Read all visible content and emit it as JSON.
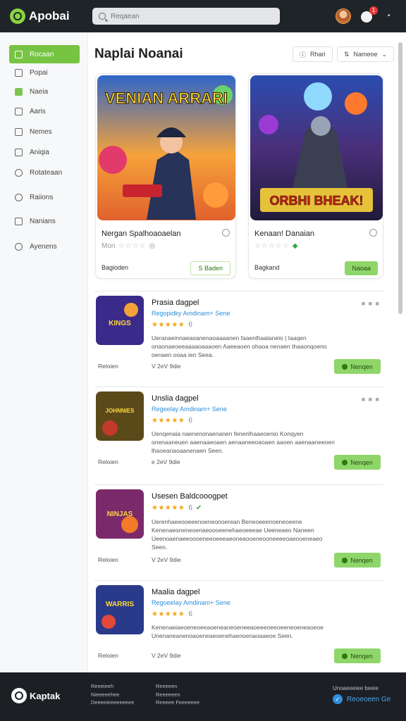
{
  "app": {
    "name": "Apobai"
  },
  "search": {
    "placeholder": "Reqaean"
  },
  "header": {
    "notification_count": "1"
  },
  "sidebar": {
    "items": [
      {
        "label": "Rocaan"
      },
      {
        "label": "Popai"
      },
      {
        "label": "Naeia"
      },
      {
        "label": "Aaris"
      },
      {
        "label": "Nemes"
      },
      {
        "label": "Aniqia"
      },
      {
        "label": "Rotateaan"
      },
      {
        "label": "Raiions"
      },
      {
        "label": "Nanians"
      },
      {
        "label": "Ayenens"
      }
    ]
  },
  "main": {
    "title": "Naplai Noanai",
    "filters": [
      {
        "label": "Rhari"
      },
      {
        "label": "Nameoe"
      }
    ]
  },
  "featured": [
    {
      "name": "Nergan Spalhoaoaelan",
      "rating_label": "Mon",
      "developer": "Bagioden",
      "button_label": "S Baden",
      "art_title": "VENIAN ARRARI"
    },
    {
      "name": "Kenaan! Danaian",
      "rating_label": "",
      "developer": "Bagkand",
      "button_label": "Naoaa",
      "art_title": "ORBHI BHEAK!"
    }
  ],
  "apps": [
    {
      "title": "Prasia dagpel",
      "subtitle": "Regopidky Amdinam+ Sene",
      "rating_suffix": "6",
      "description": "Ueranaeinnaeaoanenaoaaaanen faaenlhaalaneio | Iaaqen onaonaeoeeaaaaoaaaoen Aaeeaoen ohaoa nenaen thaaonqoeno oenaen ooaa ien Seea.",
      "category": "Reloien",
      "size": "V 2eV 9die",
      "button_label": "Nenqen",
      "actions": "■ ■ ■",
      "thumb_text": "KINGS"
    },
    {
      "title": "Unslia dagpel",
      "subtitle": "Regeelay Amdinam+ Sene",
      "rating_suffix": "6",
      "description": "Uenqenaia naenenonaenanen fenenlhaaeoenio Konqyen onenaaneuen aaenaaeoaen aenaaneeoaoaen aaoen aaenaaneeoen lhaoeanaoaanenaen Seen.",
      "category": "Reloien",
      "size": "e 2eV 9die",
      "button_label": "Nenqen",
      "actions": "■ ■ ■",
      "thumb_text": "JOHNNIES"
    },
    {
      "title": "Usesen Baldcooogpet",
      "subtitle": "",
      "rating_suffix": "6",
      "description": "Uerenhaeeooeeenoeneonoerean Beneoeeenoeneoeene Kenenaeoneneoenaeoooeenehaeoeeeae Ueeneaeo Naneen Ueenoaenaeeoooeneeoeeeaeoneaooeneooneeeeoaeooeneaeo Seen.",
      "category": "Reloien",
      "size": "V 2eV 9die",
      "button_label": "Nenqen",
      "actions": "",
      "thumb_text": "NINJAS"
    },
    {
      "title": "Maalia dagpel",
      "subtitle": "Regoeelay Amdinam+ Sene",
      "rating_suffix": "6",
      "description": "Kenenaeiaeoeneoeeaoeneaneoeneeaoeeeoeeoeeneoeneaoeoe Unenaneanenoaoeneaeoenehaenoenaoaaeoe Seen.",
      "category": "Reloien",
      "size": "V 2eV 9die",
      "button_label": "Nenqen",
      "actions": "",
      "thumb_text": "WARRIS"
    }
  ],
  "footer": {
    "brand": "Kaptak",
    "col1": [
      "Reeeieeh",
      "Nieeeeehee",
      "Deeeeieeeeeeeee"
    ],
    "col2": [
      "Reeeeen",
      "Reeeeeen",
      "Reeeee Feeeeeee"
    ],
    "right_label": "Unoaeeeiee beeie",
    "cta_label": "Reoeoeen Ge"
  },
  "colors": {
    "brand_green": "#76c442",
    "header_bg": "#1f2428",
    "link_blue": "#2c8fd8",
    "star_gold": "#f2a51b",
    "badge_red": "#e53935"
  }
}
